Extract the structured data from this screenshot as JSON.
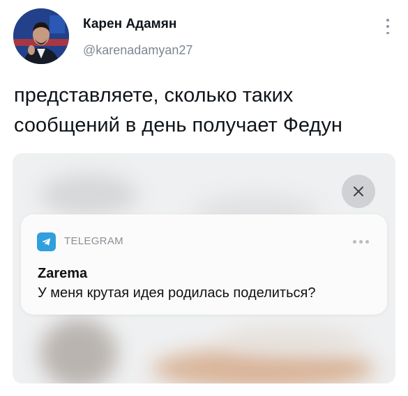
{
  "tweet": {
    "author_name": "Карен Адамян",
    "author_handle": "@karenadamyan27",
    "text_lines": [
      "представляете, сколько таких",
      "сообщений в день получает Федун"
    ],
    "more_icon": "vertical-ellipsis-icon"
  },
  "media": {
    "close_icon": "close-icon",
    "notification": {
      "app_icon": "telegram-icon",
      "app_name": "TELEGRAM",
      "more_icon": "horizontal-ellipsis-icon",
      "sender": "Zarema",
      "message": "У меня крутая идея родилась поделиться?"
    }
  },
  "colors": {
    "text_primary": "#0f1419",
    "text_secondary": "#7b8792",
    "telegram_blue": "#2f9fdd",
    "notification_bg": "#fbfbfb",
    "media_bg": "#eff0f1"
  }
}
